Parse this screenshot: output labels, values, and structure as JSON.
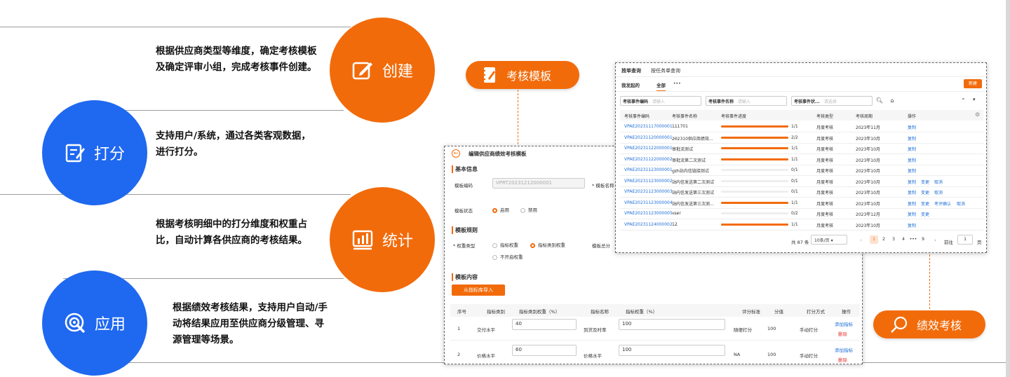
{
  "features": [
    {
      "label": "创建",
      "icon": "edit-icon",
      "desc": "根据供应商类型等维度，确定考核模板及确定评审小组，完成考核事件创建。"
    },
    {
      "label": "打分",
      "icon": "scoring-icon",
      "desc": "支持用户/系统，通过各类客观数据，进行打分。"
    },
    {
      "label": "统计",
      "icon": "chart-icon",
      "desc": "根据考核明细中的打分维度和权重占比，自动计算各供应商的考核结果。"
    },
    {
      "label": "应用",
      "icon": "target-icon",
      "desc": "根据绩效考核结果，支持用户自动/手动将结果应用至供应商分级管理、寻源管理等场景。"
    }
  ],
  "pills": {
    "template": "考核模板",
    "perf": "绩效考核"
  },
  "template_panel": {
    "title": "编辑供应商绩效考核模板",
    "basic": "基本信息",
    "code_label": "模板编码",
    "code_value": "VPRT20231212000001",
    "name_label": "* 模板名称",
    "status_label": "模板状态",
    "status_on": "启用",
    "status_off": "禁用",
    "rules": "模板规则",
    "weight_type_label": "* 权重类型",
    "opt1": "指标权重",
    "opt2": "指标类别权重",
    "opt3": "不开启权重",
    "total_label": "模板总分",
    "content": "模板内容",
    "import_btn": "从指标库导入",
    "headers": [
      "序号",
      "指标类别",
      "指标类别权重（%）",
      "指标名称",
      "指标权重（%）",
      "评分标准",
      "分值",
      "打分方式",
      "操作"
    ],
    "rows": [
      {
        "no": "1",
        "cat": "交付水平",
        "catw": "40",
        "name": "到货及时率",
        "w": "100",
        "std": "随便打分",
        "score": "100",
        "mode": "手动打分",
        "add": "添加指标",
        "del": "删除"
      },
      {
        "no": "2",
        "cat": "价格水平",
        "catw": "60",
        "name": "价格水平",
        "w": "100",
        "std": "NA",
        "score": "100",
        "mode": "手动打分",
        "add": "添加指标",
        "del": "删除"
      }
    ]
  },
  "list_panel": {
    "tabs": [
      "按单查询",
      "按任务单查询"
    ],
    "subtabs": [
      "我发起的",
      "全部"
    ],
    "more": "•••",
    "new_btn": "新建",
    "filters": [
      {
        "label": "考核事件编码",
        "ph": "请输入"
      },
      {
        "label": "考核事件名称",
        "ph": "请输入"
      },
      {
        "label": "考核事件状...",
        "ph": "请选择"
      }
    ],
    "headers": [
      "考核事件编码",
      "考核事件名称",
      "考核事件进度",
      "考核类型",
      "考核周期",
      "操作"
    ],
    "rows": [
      {
        "code": "VPAE20231117000001 ...",
        "name": "111701",
        "prog": 1.0,
        "ratio": "1/1",
        "type": "月度考核",
        "period": "2023年11月",
        "ops": [
          "复制"
        ]
      },
      {
        "code": "VPAE20231120000001 ...",
        "name": "202310供应商绩效...",
        "prog": 1.0,
        "ratio": "2/2",
        "type": "月度考核",
        "period": "2023年10月",
        "ops": [
          "复制"
        ]
      },
      {
        "code": "VPAE20231122000001 ...",
        "name": "审批流测试",
        "prog": 1.0,
        "ratio": "1/1",
        "type": "月度考核",
        "period": "2023年10月",
        "ops": [
          "复制"
        ]
      },
      {
        "code": "VPAE20231122000002 ...",
        "name": "审批流第二次测试",
        "prog": 1.0,
        "ratio": "1/1",
        "type": "月度考核",
        "period": "2023年10月",
        "ops": [
          "复制"
        ]
      },
      {
        "code": "VPAE20231123000001 ...",
        "name": "gzh站内信链接测试",
        "prog": 0.0,
        "ratio": "0/1",
        "type": "月度考核",
        "period": "2023年10月",
        "ops": [
          "复制"
        ]
      },
      {
        "code": "VPAE20231123000002 ...",
        "name": "站内信发送第二次测试",
        "prog": 0.0,
        "ratio": "0/1",
        "type": "月度考核",
        "period": "2023年10月",
        "ops": [
          "复制",
          "变更",
          "取消"
        ]
      },
      {
        "code": "VPAE20231123000003 ...",
        "name": "站内信发送第三次测试",
        "prog": 0.0,
        "ratio": "0/1",
        "type": "月度考核",
        "period": "2023年10月",
        "ops": [
          "复制",
          "变更",
          "取消"
        ]
      },
      {
        "code": "VPAE20231123000004 ...",
        "name": "站内信发送第三次测...",
        "prog": 1.0,
        "ratio": "1/1",
        "type": "月度考核",
        "period": "2023年10月",
        "ops": [
          "复制",
          "变更",
          "考评确认",
          "取消"
        ]
      },
      {
        "code": "VPAE20231123000005 ...",
        "name": "vser",
        "prog": 0.0,
        "ratio": "0/2",
        "type": "月度考核",
        "period": "2023年12月",
        "ops": [
          "复制",
          "变更"
        ]
      },
      {
        "code": "VPAE20231124000002 ...",
        "name": "12",
        "prog": 1.0,
        "ratio": "1/1",
        "type": "月度考核",
        "period": "2023年10月",
        "ops": [
          "复制"
        ]
      }
    ],
    "total": "共 87 条",
    "page_size": "10条/页",
    "pages": [
      "1",
      "2",
      "3",
      "4",
      "•••",
      "9"
    ],
    "goto": "前往",
    "goto_value": "1",
    "page_unit": "页"
  }
}
